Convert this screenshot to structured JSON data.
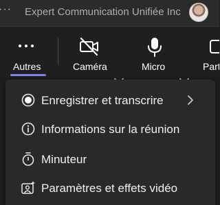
{
  "titlebar": {
    "title": "Expert Communication Unifiée Inc"
  },
  "toolbar": {
    "more_label": "Autres",
    "camera_label": "Caméra",
    "mic_label": "Micro",
    "share_label": "Parta"
  },
  "menu": {
    "items": [
      {
        "label": "Enregistrer et transcrire",
        "icon": "record-icon"
      },
      {
        "label": "Informations sur la réunion",
        "icon": "info-icon"
      },
      {
        "label": "Minuteur",
        "icon": "timer-icon"
      },
      {
        "label": "Paramètres et effets vidéo",
        "icon": "video-effects-icon"
      }
    ]
  },
  "colors": {
    "background": "#1f1f1f",
    "menu_background": "#292929",
    "accent": "#7f85f5"
  }
}
